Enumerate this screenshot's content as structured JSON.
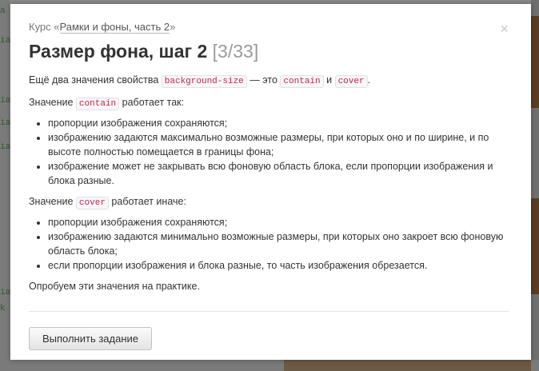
{
  "modal": {
    "close_symbol": "×",
    "breadcrumb": {
      "prefix": "Курс «",
      "course_link": "Рамки и фоны, часть 2",
      "suffix": "»"
    },
    "title": {
      "main": "Размер фона, шаг 2",
      "step": "[3/33]"
    },
    "intro": {
      "t1": "Ещё два значения свойства",
      "code1": "background-size",
      "t2": "— это",
      "code2": "contain",
      "t3": "и",
      "code3": "cover",
      "t4": "."
    },
    "contain_section": {
      "t1": "Значение",
      "code": "contain",
      "t2": "работает так:",
      "items": [
        "пропорции изображения сохраняются;",
        "изображению задаются максимально возможные размеры, при которых оно и по ширине, и по высоте полностью помещается в границы фона;",
        "изображение может не закрывать всю фоновую область блока, если пропорции изображения и блока разные."
      ]
    },
    "cover_section": {
      "t1": "Значение",
      "code": "cover",
      "t2": "работает иначе:",
      "items": [
        "пропорции изображения сохраняются;",
        "изображению задаются минимально возможные размеры, при которых оно закроет всю фоновую область блока;",
        "если пропорции изображения и блока разные, то часть изображения обрезается."
      ]
    },
    "outro": "Опробуем эти значения на практике.",
    "action_button": "Выполнить задание"
  },
  "background": {
    "left_fragments": [
      "a",
      "ia",
      "ia",
      "ia",
      "ia",
      "ia",
      "k"
    ]
  }
}
